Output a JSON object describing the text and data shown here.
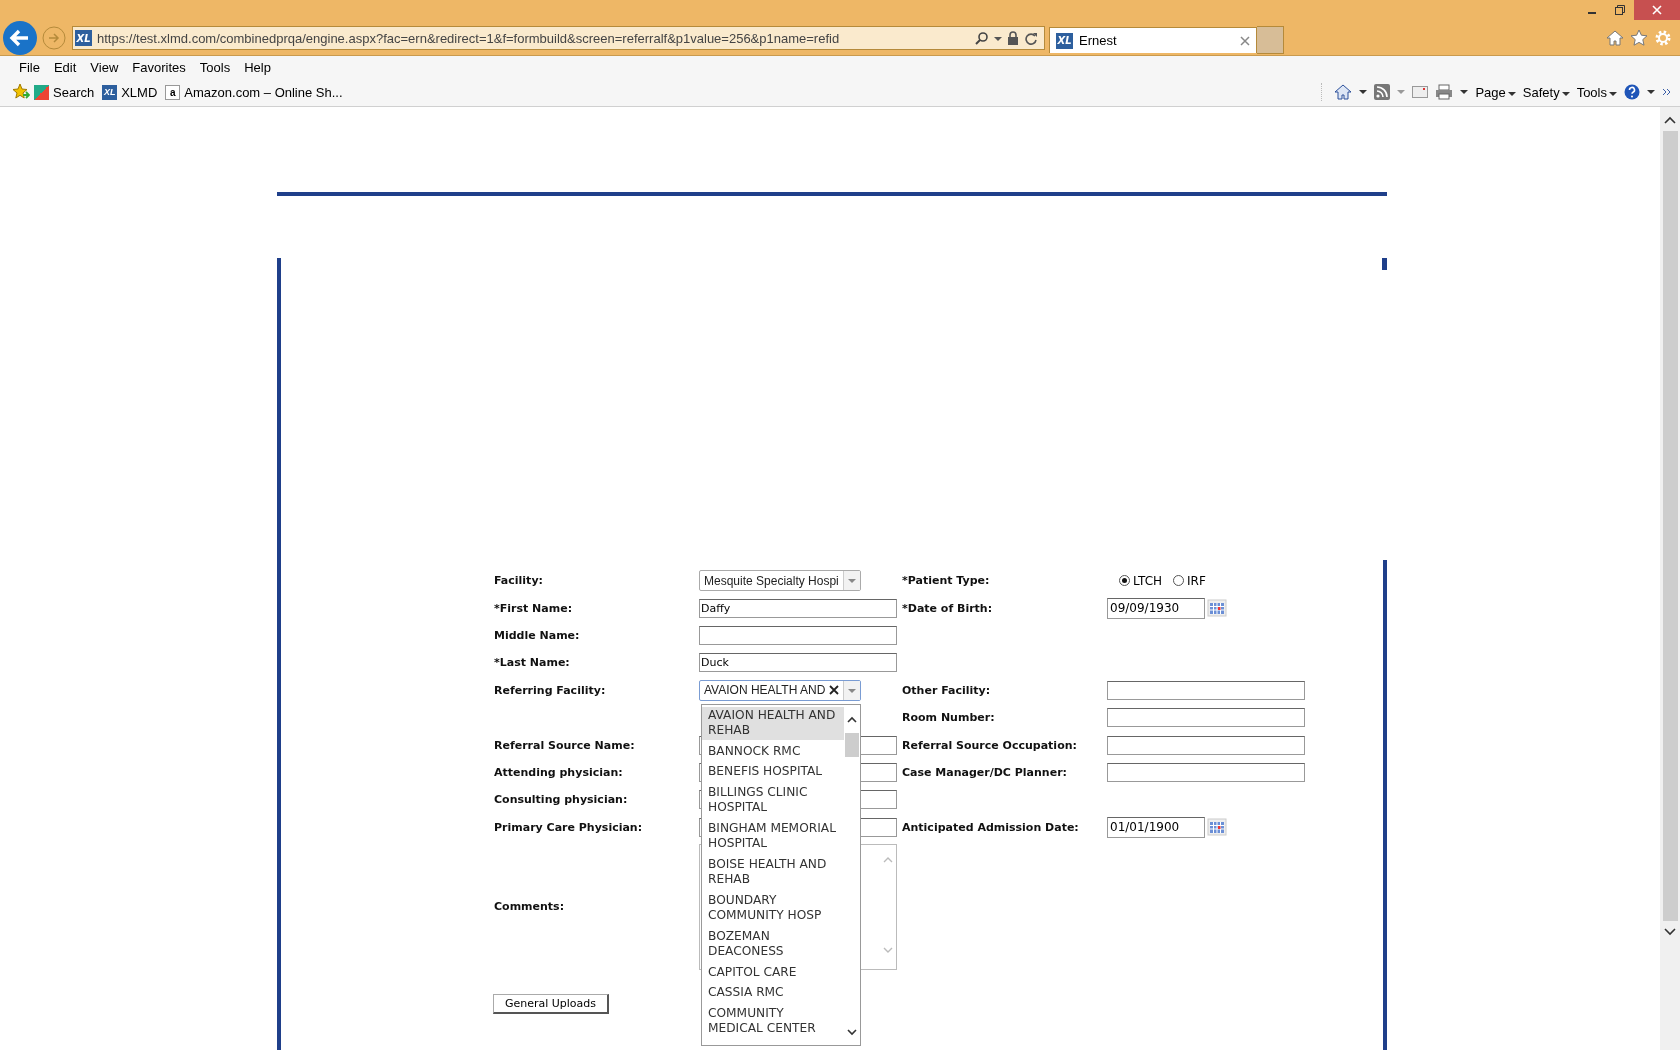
{
  "browser": {
    "url": "https://test.xlmd.com/combinedprqa/engine.aspx?fac=ern&redirect=1&f=formbuild&screen=referralf&p1value=256&p1name=refid",
    "site_icon_text": "XL",
    "tab_icon_text": "XL",
    "tab_title": "Ernest",
    "menu": [
      "File",
      "Edit",
      "View",
      "Favorites",
      "Tools",
      "Help"
    ],
    "favorites": [
      {
        "label": "Search"
      },
      {
        "icon_text": "XL",
        "label": "XLMD"
      },
      {
        "icon_text": "a",
        "label": "Amazon.com – Online Sh..."
      }
    ],
    "command_bar": [
      "Page",
      "Safety",
      "Tools"
    ]
  },
  "form": {
    "facility": {
      "label": "Facility:",
      "value": "Mesquite Specialty  Hospi"
    },
    "patient_type": {
      "label": "*Patient Type:",
      "options": [
        {
          "label": "LTCH",
          "selected": true
        },
        {
          "label": "IRF",
          "selected": false
        }
      ]
    },
    "first_name": {
      "label": "*First Name:",
      "value": "Daffy"
    },
    "date_of_birth": {
      "label": "*Date of Birth:",
      "value": "09/09/1930"
    },
    "middle_name": {
      "label": "Middle Name:"
    },
    "last_name": {
      "label": "*Last Name:",
      "value": "Duck"
    },
    "referring_facility": {
      "label": "Referring Facility:",
      "value": "AVAION HEALTH AND",
      "expanded": true,
      "options": [
        {
          "label": "AVAION HEALTH AND REHAB",
          "selected": true
        },
        {
          "label": "BANNOCK RMC",
          "selected": false
        },
        {
          "label": "BENEFIS HOSPITAL",
          "selected": false
        },
        {
          "label": "BILLINGS CLINIC HOSPITAL",
          "selected": false
        },
        {
          "label": "BINGHAM MEMORIAL HOSPITAL",
          "selected": false
        },
        {
          "label": "BOISE HEALTH AND REHAB",
          "selected": false
        },
        {
          "label": "BOUNDARY COMMUNITY HOSP",
          "selected": false
        },
        {
          "label": "BOZEMAN DEACONESS",
          "selected": false
        },
        {
          "label": "CAPITOL CARE",
          "selected": false
        },
        {
          "label": "CASSIA RMC",
          "selected": false
        },
        {
          "label": "COMMUNITY MEDICAL CENTER",
          "selected": false
        }
      ]
    },
    "other_facility": {
      "label": "Other Facility:"
    },
    "room_number": {
      "label": "Room Number:"
    },
    "referral_source_name": {
      "label": "Referral Source Name:"
    },
    "referral_source_occupation": {
      "label": "Referral Source Occupation:"
    },
    "attending_physician": {
      "label": "Attending physician:"
    },
    "case_manager": {
      "label": "Case Manager/DC Planner:"
    },
    "consulting_physician": {
      "label": "Consulting physician:"
    },
    "primary_care_physician": {
      "label": "Primary Care Physician:"
    },
    "anticipated_admission_date": {
      "label": "Anticipated Admission Date:",
      "value": "01/01/1900"
    },
    "comments": {
      "label": "Comments:"
    },
    "upload_button": "General Uploads"
  }
}
